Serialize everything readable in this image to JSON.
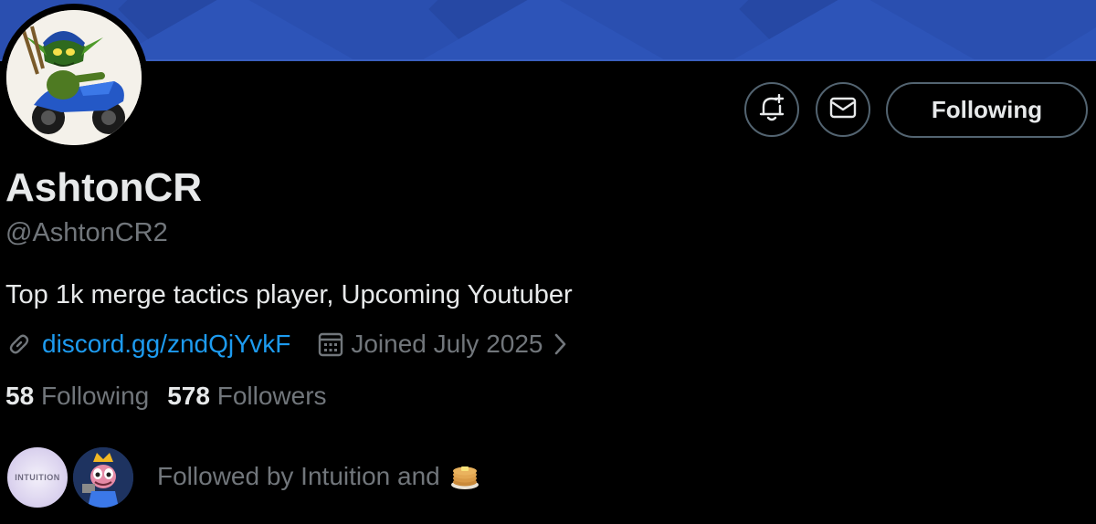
{
  "profile": {
    "display_name": "AshtonCR",
    "handle": "@AshtonCR2",
    "bio": "Top 1k merge tactics player, Upcoming Youtuber",
    "link": "discord.gg/zndQjYvkF",
    "joined": "Joined July 2025",
    "following_count": "58",
    "following_label": "Following",
    "followers_count": "578",
    "followers_label": "Followers",
    "followed_by": "Followed by Intuition and",
    "followed_by_avatar_text": "INTUITION"
  },
  "actions": {
    "follow_button": "Following",
    "bell_icon": "bell-plus-icon",
    "message_icon": "mail-icon"
  },
  "colors": {
    "background": "#000000",
    "primary_text": "#e7e9ea",
    "secondary_text": "#71767b",
    "link": "#1d9bf0",
    "banner": "#2a4fb0",
    "button_border": "#536471"
  }
}
